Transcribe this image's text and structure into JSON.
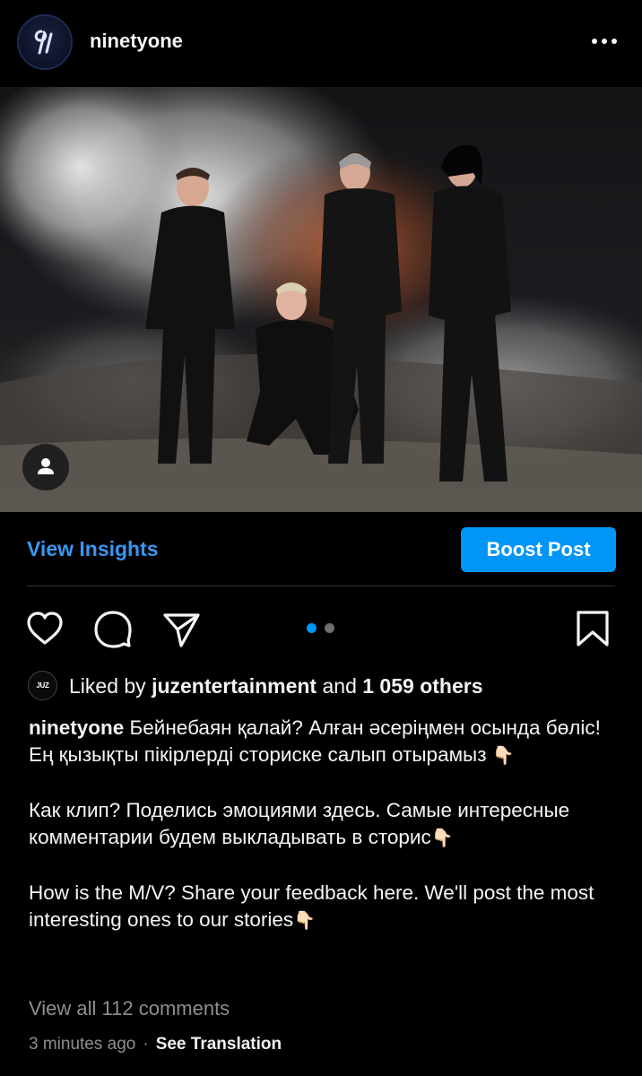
{
  "header": {
    "username": "ninetyone",
    "avatar_icon": "ninetyone-logo-icon",
    "more_icon": "more-dots-icon"
  },
  "post": {
    "image_icon": "group-photo",
    "tag_icon": "person-tag-icon",
    "carousel": {
      "current": 1,
      "total": 2
    }
  },
  "insights": {
    "view_insights_label": "View Insights",
    "boost_label": "Boost Post"
  },
  "actions": {
    "like_icon": "heart-icon",
    "comment_icon": "comment-icon",
    "share_icon": "send-icon",
    "save_icon": "bookmark-icon"
  },
  "likes": {
    "logo_text": "JUZ",
    "prefix": "Liked by",
    "user": "juzentertainment",
    "middle": "and",
    "count": "1 059 others"
  },
  "caption": {
    "username": "ninetyone",
    "kazakh": "Бейнебаян қалай? Алған әсеріңмен осында бөліс! Ең қызықты пікірлерді сториске салып отырамыз",
    "russian": "Как клип? Поделись эмоциями здесь. Самые интересные комментарии будем выкладывать в сторис",
    "english": "How is the M/V? Share your feedback here. We'll post the most interesting ones to our stories",
    "emoji": "👇🏻"
  },
  "comments": {
    "view_all": "View all 112 comments"
  },
  "meta": {
    "time": "3 minutes ago",
    "separator": "·",
    "see_translation": "See Translation"
  },
  "colors": {
    "accent": "#0095f6",
    "link": "#3897f0",
    "muted": "#8e8e8e",
    "background": "#000000"
  }
}
